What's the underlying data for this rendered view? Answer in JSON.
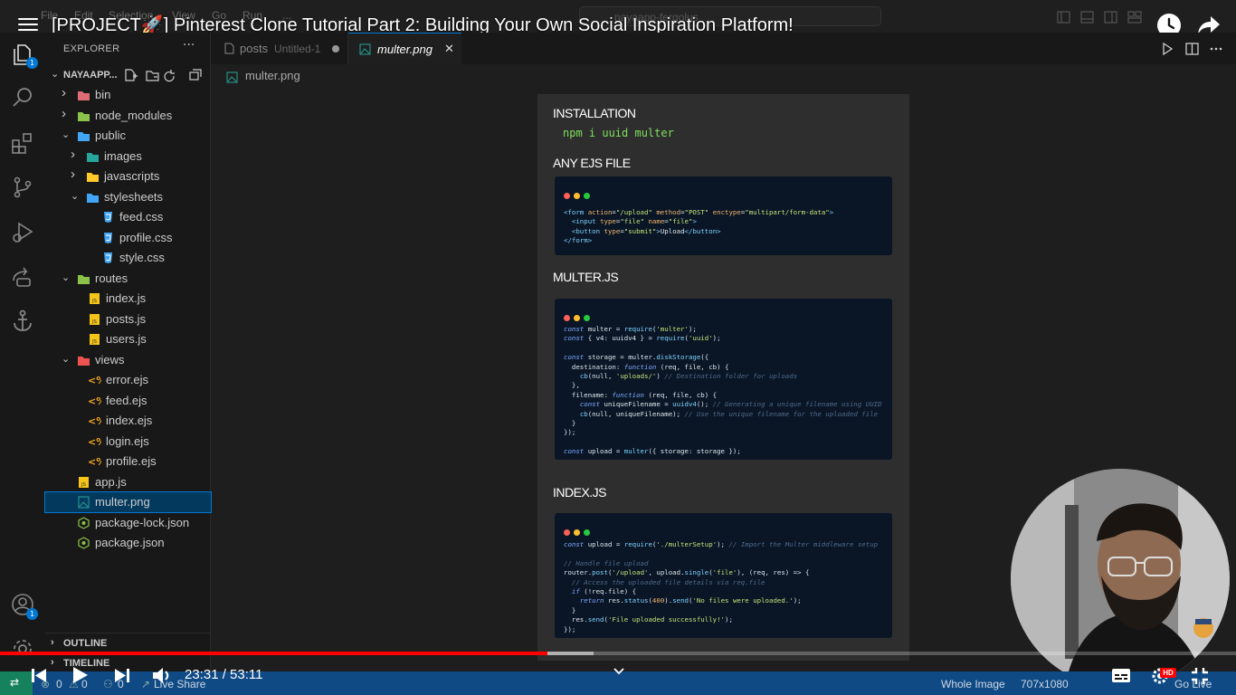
{
  "video": {
    "title": "[PROJECT🚀] Pinterest Clone Tutorial Part 2: Building Your Own Social Inspiration Platform!",
    "time_display": "23:31 / 53:11",
    "progress": 0.443,
    "buffered": 0.48,
    "hd_badge": "HD"
  },
  "editor_menu_ghost": [
    "File",
    "Edit",
    "Selection",
    "View",
    "Go",
    "Run",
    "..."
  ],
  "command_center": "nayaapp-fergolus",
  "activity": {
    "explorer_badge": "1",
    "accounts_badge": "1"
  },
  "explorer": {
    "title": "EXPLORER",
    "more": "···",
    "project_name": "NAYAAPP...",
    "items": [
      {
        "label": "bin",
        "type": "folder",
        "depth": 1,
        "open": false,
        "color": "#e06c75"
      },
      {
        "label": "node_modules",
        "type": "folder",
        "depth": 1,
        "open": false,
        "color": "#8bc34a"
      },
      {
        "label": "public",
        "type": "folder",
        "depth": 1,
        "open": true,
        "color": "#42a5f5"
      },
      {
        "label": "images",
        "type": "folder",
        "depth": 2,
        "open": false,
        "color": "#26a69a"
      },
      {
        "label": "javascripts",
        "type": "folder",
        "depth": 2,
        "open": false,
        "color": "#ffca28"
      },
      {
        "label": "stylesheets",
        "type": "folder",
        "depth": 2,
        "open": true,
        "color": "#42a5f5"
      },
      {
        "label": "feed.css",
        "type": "css",
        "depth": 3
      },
      {
        "label": "profile.css",
        "type": "css",
        "depth": 3
      },
      {
        "label": "style.css",
        "type": "css",
        "depth": 3
      },
      {
        "label": "routes",
        "type": "folder",
        "depth": 1,
        "open": true,
        "color": "#8bc34a"
      },
      {
        "label": "index.js",
        "type": "js",
        "depth": 2
      },
      {
        "label": "posts.js",
        "type": "js",
        "depth": 2
      },
      {
        "label": "users.js",
        "type": "js",
        "depth": 2
      },
      {
        "label": "views",
        "type": "folder",
        "depth": 1,
        "open": true,
        "color": "#ef5350"
      },
      {
        "label": "error.ejs",
        "type": "ejs",
        "depth": 2
      },
      {
        "label": "feed.ejs",
        "type": "ejs",
        "depth": 2
      },
      {
        "label": "index.ejs",
        "type": "ejs",
        "depth": 2
      },
      {
        "label": "login.ejs",
        "type": "ejs",
        "depth": 2
      },
      {
        "label": "profile.ejs",
        "type": "ejs",
        "depth": 2
      },
      {
        "label": "app.js",
        "type": "js",
        "depth": 1
      },
      {
        "label": "multer.png",
        "type": "png",
        "depth": 1,
        "selected": true
      },
      {
        "label": "package-lock.json",
        "type": "json",
        "depth": 1
      },
      {
        "label": "package.json",
        "type": "json",
        "depth": 1
      }
    ],
    "outline": "OUTLINE",
    "timeline": "TIMELINE"
  },
  "tabs": [
    {
      "label": "posts",
      "sub": "Untitled-1",
      "active": false
    },
    {
      "label": "multer.png",
      "active": true
    }
  ],
  "breadcrumb": "multer.png",
  "image": {
    "installation_heading": "INSTALLATION",
    "install_cmd": "npm i uuid multer",
    "ejs_heading": "ANY EJS FILE",
    "multer_heading": "MULTER.JS",
    "index_heading": "INDEX.JS"
  },
  "status": {
    "errors": "0",
    "warnings": "0",
    "ports": "0",
    "live_share": "Live Share",
    "whole_image": "Whole Image",
    "dimensions": "707x1080",
    "go_live": "Go Live"
  }
}
